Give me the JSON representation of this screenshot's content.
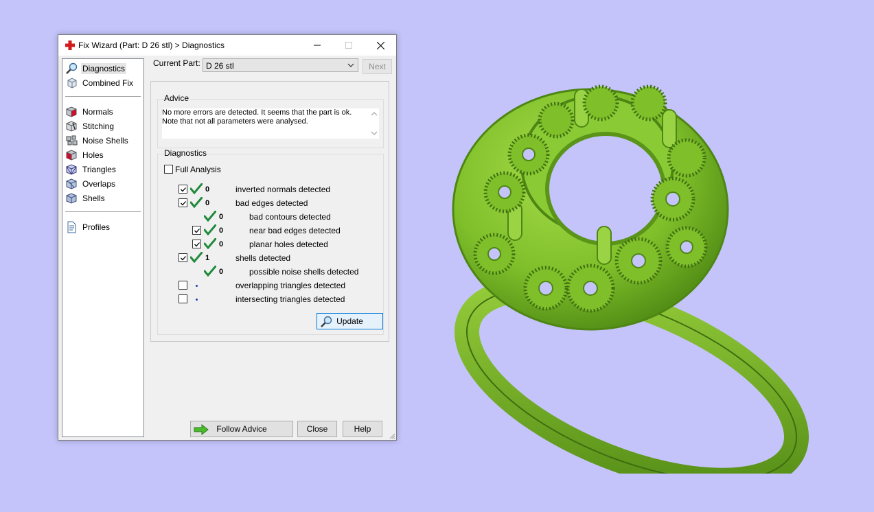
{
  "window": {
    "title": "Fix Wizard (Part: D 26 stl) > Diagnostics",
    "controls": [
      "minimize-icon",
      "maximize-icon",
      "close-icon"
    ]
  },
  "sidebar": {
    "items": [
      {
        "label": "Diagnostics",
        "icon": "magnifier-icon",
        "selected": true
      },
      {
        "label": "Combined Fix",
        "icon": "combined-fix-icon"
      },
      {
        "label": "Normals",
        "icon": "normals-cube-icon"
      },
      {
        "label": "Stitching",
        "icon": "stitching-cube-icon"
      },
      {
        "label": "Noise Shells",
        "icon": "noise-shells-icon"
      },
      {
        "label": "Holes",
        "icon": "holes-cube-icon"
      },
      {
        "label": "Triangles",
        "icon": "triangles-cube-icon"
      },
      {
        "label": "Overlaps",
        "icon": "overlaps-cube-icon"
      },
      {
        "label": "Shells",
        "icon": "shells-cube-icon"
      },
      {
        "label": "Profiles",
        "icon": "document-icon"
      }
    ]
  },
  "current_part": {
    "label": "Current Part:",
    "value": "D 26 stl",
    "next_label": "Next"
  },
  "advice": {
    "title": "Advice",
    "line1": "No more errors are detected. It seems that the part is ok.",
    "line2": "Note that not all parameters were analysed."
  },
  "diagnostics": {
    "title": "Diagnostics",
    "full_analysis_label": "Full Analysis",
    "full_analysis_checked": false,
    "rows": [
      {
        "checked": true,
        "status": "ok",
        "count": "0",
        "label": "inverted normals detected"
      },
      {
        "checked": true,
        "status": "ok",
        "count": "0",
        "label": "bad edges detected"
      },
      {
        "checked": null,
        "status": "ok",
        "count": "0",
        "label": "bad contours detected"
      },
      {
        "checked": true,
        "status": "ok",
        "count": "0",
        "label": "near bad edges detected"
      },
      {
        "checked": true,
        "status": "ok",
        "count": "0",
        "label": "planar holes detected"
      },
      {
        "checked": true,
        "status": "ok",
        "count": "1",
        "label": "shells detected"
      },
      {
        "checked": null,
        "status": "ok",
        "count": "0",
        "label": "possible noise shells detected"
      },
      {
        "checked": false,
        "status": "not-analysed",
        "count": "",
        "label": "overlapping triangles detected"
      },
      {
        "checked": false,
        "status": "not-analysed",
        "count": "",
        "label": "intersecting triangles detected"
      }
    ],
    "update_label": "Update"
  },
  "footer": {
    "follow_advice_label": "Follow Advice",
    "close_label": "Close",
    "help_label": "Help"
  },
  "colors": {
    "desktop_background": "#c4c4fb",
    "model_green": "#7fbf2a",
    "check_green": "#1f8a3a"
  }
}
